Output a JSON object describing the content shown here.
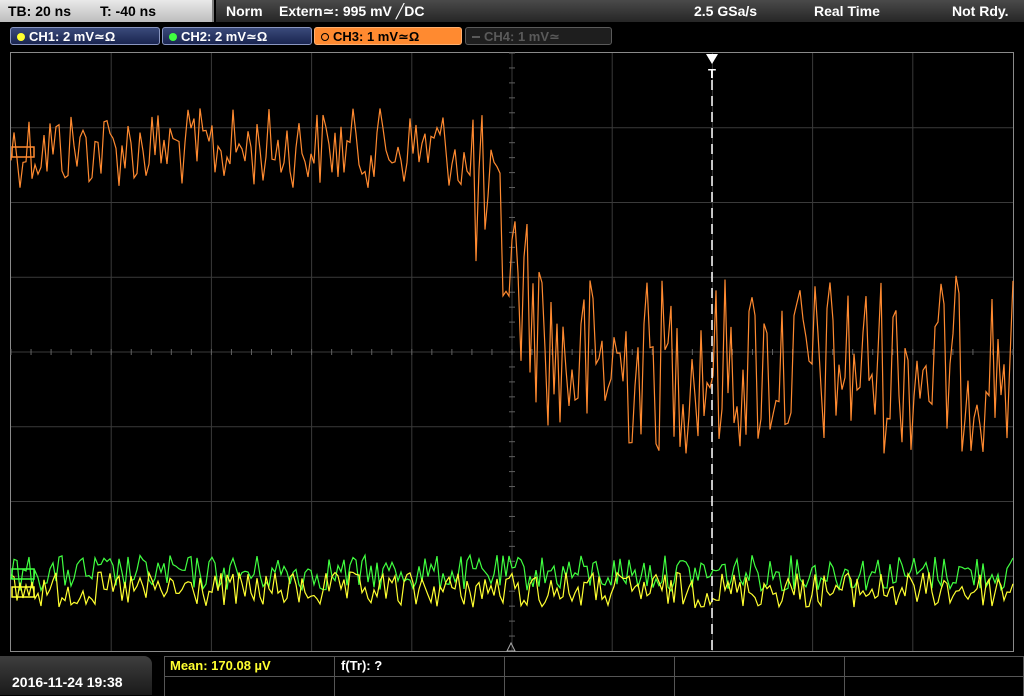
{
  "status": {
    "timebase": "TB: 20 ns",
    "trigger_time": "T: -40 ns",
    "mode": "Norm",
    "trigger_source": "Extern≃: 995 mV ╱DC",
    "sample_rate": "2.5 GSa/s",
    "acq_mode": "Real Time",
    "ready_state": "Not Rdy."
  },
  "channels": [
    {
      "label": "CH1: 2 mV≃Ω",
      "color": "#ffff30",
      "active": true
    },
    {
      "label": "CH2: 2 mV≃Ω",
      "color": "#40ff40",
      "active": true
    },
    {
      "label": "CH3: 1 mV≃Ω",
      "color": "#ff8a30",
      "active": true
    },
    {
      "label": "CH4: 1 mV≃",
      "color": "#5a5a5a",
      "active": false
    }
  ],
  "markers": {
    "trigger_marker": "T"
  },
  "footer": {
    "datetime": "2016-11-24 19:38",
    "meas1": "Mean: 170.08 µV",
    "meas2": "f(Tr): ?"
  },
  "colors": {
    "ch1": "#ffff30",
    "ch2": "#40ff40",
    "ch3": "#ff8a30",
    "grid": "#3a3a3a",
    "trigger_line": "#ffffff"
  }
}
